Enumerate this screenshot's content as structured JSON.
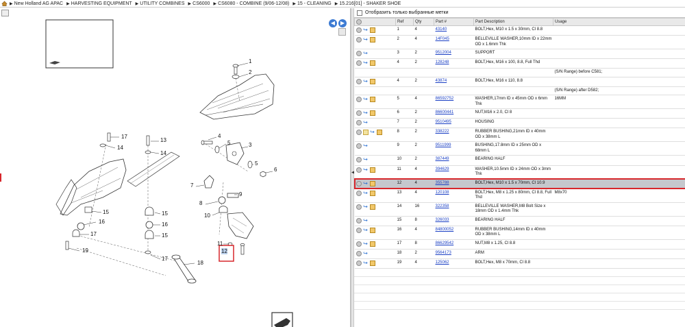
{
  "breadcrumb": [
    "New Holland AG APAC",
    "HARVESTING EQUIPMENT",
    "UTILITY COMBINES",
    "CS6000",
    "CS6080 - COMBINE (9/06-12/08)",
    "15 - CLEANING",
    "15.216[01] - SHAKER SHOE"
  ],
  "filter": {
    "label": "Отобразить только выбранные метки"
  },
  "table": {
    "headers": {
      "ref": "Ref",
      "qty": "Qty",
      "part": "Part #",
      "desc": "Part Description",
      "usage": "Usage"
    },
    "rows": [
      {
        "ref": "1",
        "qty": "4",
        "part": "43140",
        "desc": "BOLT,Hex, M10 x 1.5 x 30mm, Cl 8.8",
        "usage": "",
        "icons": [
          "gray",
          "link",
          "box"
        ]
      },
      {
        "ref": "2",
        "qty": "4",
        "part": "14F045",
        "desc": "BELLEVILLE WASHER,10mm ID x 22mm OD x 1.6mm Thk",
        "usage": "",
        "icons": [
          "gray",
          "link",
          "box"
        ]
      },
      {
        "ref": "3",
        "qty": "2",
        "part": "9512004",
        "desc": "SUPPORT",
        "usage": "",
        "icons": [
          "gray",
          "link"
        ]
      },
      {
        "ref": "4",
        "qty": "2",
        "part": "128248",
        "desc": "BOLT,Hex, M16 x 100, 8.8, Full Thd",
        "usage": "",
        "icons": [
          "gray",
          "link",
          "box"
        ]
      },
      {
        "range": "(S/N Range) before C581;"
      },
      {
        "ref": "4",
        "qty": "2",
        "part": "43874",
        "desc": "BOLT,Hex, M16 x 110, 8.8",
        "usage": "",
        "icons": [
          "gray",
          "link",
          "box"
        ]
      },
      {
        "range": "(S/N Range) after D582;"
      },
      {
        "ref": "5",
        "qty": "4",
        "part": "86592752",
        "desc": "WASHER,17mm ID x 45mm OD x 6mm Thk",
        "usage": "16MM",
        "icons": [
          "gray",
          "link",
          "box"
        ]
      },
      {
        "ref": "6",
        "qty": "2",
        "part": "86600441",
        "desc": "NUT,M16 x 2.0, Cl 8",
        "usage": "",
        "icons": [
          "gray",
          "link",
          "box"
        ]
      },
      {
        "ref": "7",
        "qty": "2",
        "part": "9510495",
        "desc": "HOUSING",
        "usage": "",
        "icons": [
          "gray",
          "link"
        ]
      },
      {
        "ref": "8",
        "qty": "2",
        "part": "338222",
        "desc": "RUBBER BUSHING,21mm ID x 40mm OD x 38mm L",
        "usage": "",
        "icons": [
          "gray",
          "rep",
          "link",
          "box"
        ]
      },
      {
        "ref": "9",
        "qty": "2",
        "part": "9511999",
        "desc": "BUSHING,17.8mm ID x 25mm OD x 68mm L",
        "usage": "",
        "icons": [
          "gray",
          "link"
        ]
      },
      {
        "ref": "10",
        "qty": "2",
        "part": "387449",
        "desc": "BEARING HALF",
        "usage": "",
        "icons": [
          "gray",
          "link"
        ]
      },
      {
        "ref": "11",
        "qty": "4",
        "part": "394629",
        "desc": "WASHER,10.5mm ID x 24mm OD x 3mm Thk",
        "usage": "",
        "icons": [
          "gray",
          "link",
          "box"
        ]
      },
      {
        "ref": "12",
        "qty": "4",
        "part": "355788",
        "desc": "BOLT,Hex, M10 x 1.5 x 70mm, Cl 10.9",
        "usage": "",
        "icons": [
          "gray",
          "link",
          "box"
        ],
        "selected": true
      },
      {
        "ref": "13",
        "qty": "4",
        "part": "120108",
        "desc": "BOLT,Hex, M8 x 1.25 x 80mm, Cl 8.8, Full Thd",
        "usage": "M8x70",
        "icons": [
          "gray",
          "link",
          "box"
        ]
      },
      {
        "ref": "14",
        "qty": "16",
        "part": "322358",
        "desc": "BELLEVILLE WASHER,M8 Bolt Size x 18mm OD x 1.4mm Thk",
        "usage": "",
        "icons": [
          "gray",
          "link",
          "box"
        ]
      },
      {
        "ref": "15",
        "qty": "8",
        "part": "326033",
        "desc": "BEARING HALF",
        "usage": "",
        "icons": [
          "gray",
          "link"
        ]
      },
      {
        "ref": "16",
        "qty": "4",
        "part": "84800052",
        "desc": "RUBBER BUSHING,14mm ID x 40mm OD x 38mm L",
        "usage": "",
        "icons": [
          "gray",
          "link",
          "box"
        ]
      },
      {
        "ref": "17",
        "qty": "8",
        "part": "86629542",
        "desc": "NUT,M8 x 1.25, Cl 8.8",
        "usage": "",
        "icons": [
          "gray",
          "link",
          "box"
        ]
      },
      {
        "ref": "18",
        "qty": "2",
        "part": "9564173",
        "desc": "ARM",
        "usage": "",
        "icons": [
          "gray",
          "link"
        ]
      },
      {
        "ref": "19",
        "qty": "4",
        "part": "125062",
        "desc": "BOLT,Hex, M8 x 70mm, Cl 8.8",
        "usage": "",
        "icons": [
          "gray",
          "link",
          "box"
        ]
      }
    ]
  },
  "callouts": [
    "1",
    "2",
    "3",
    "4",
    "5",
    "6",
    "7",
    "8",
    "9",
    "10",
    "11",
    "12",
    "13",
    "14",
    "14",
    "15",
    "15",
    "15",
    "16",
    "16",
    "17",
    "17",
    "17",
    "18",
    "19"
  ],
  "colors": {
    "selection_outline": "#d7262b",
    "selected_row": "#c5c8cd",
    "link": "#1a3fc4",
    "nav_button": "#3d7bd3"
  },
  "icons": {
    "home": "home-icon",
    "nav_back": "arrow-left-icon",
    "nav_forward": "arrow-right-icon",
    "splitter": "chevron-left-icon"
  }
}
